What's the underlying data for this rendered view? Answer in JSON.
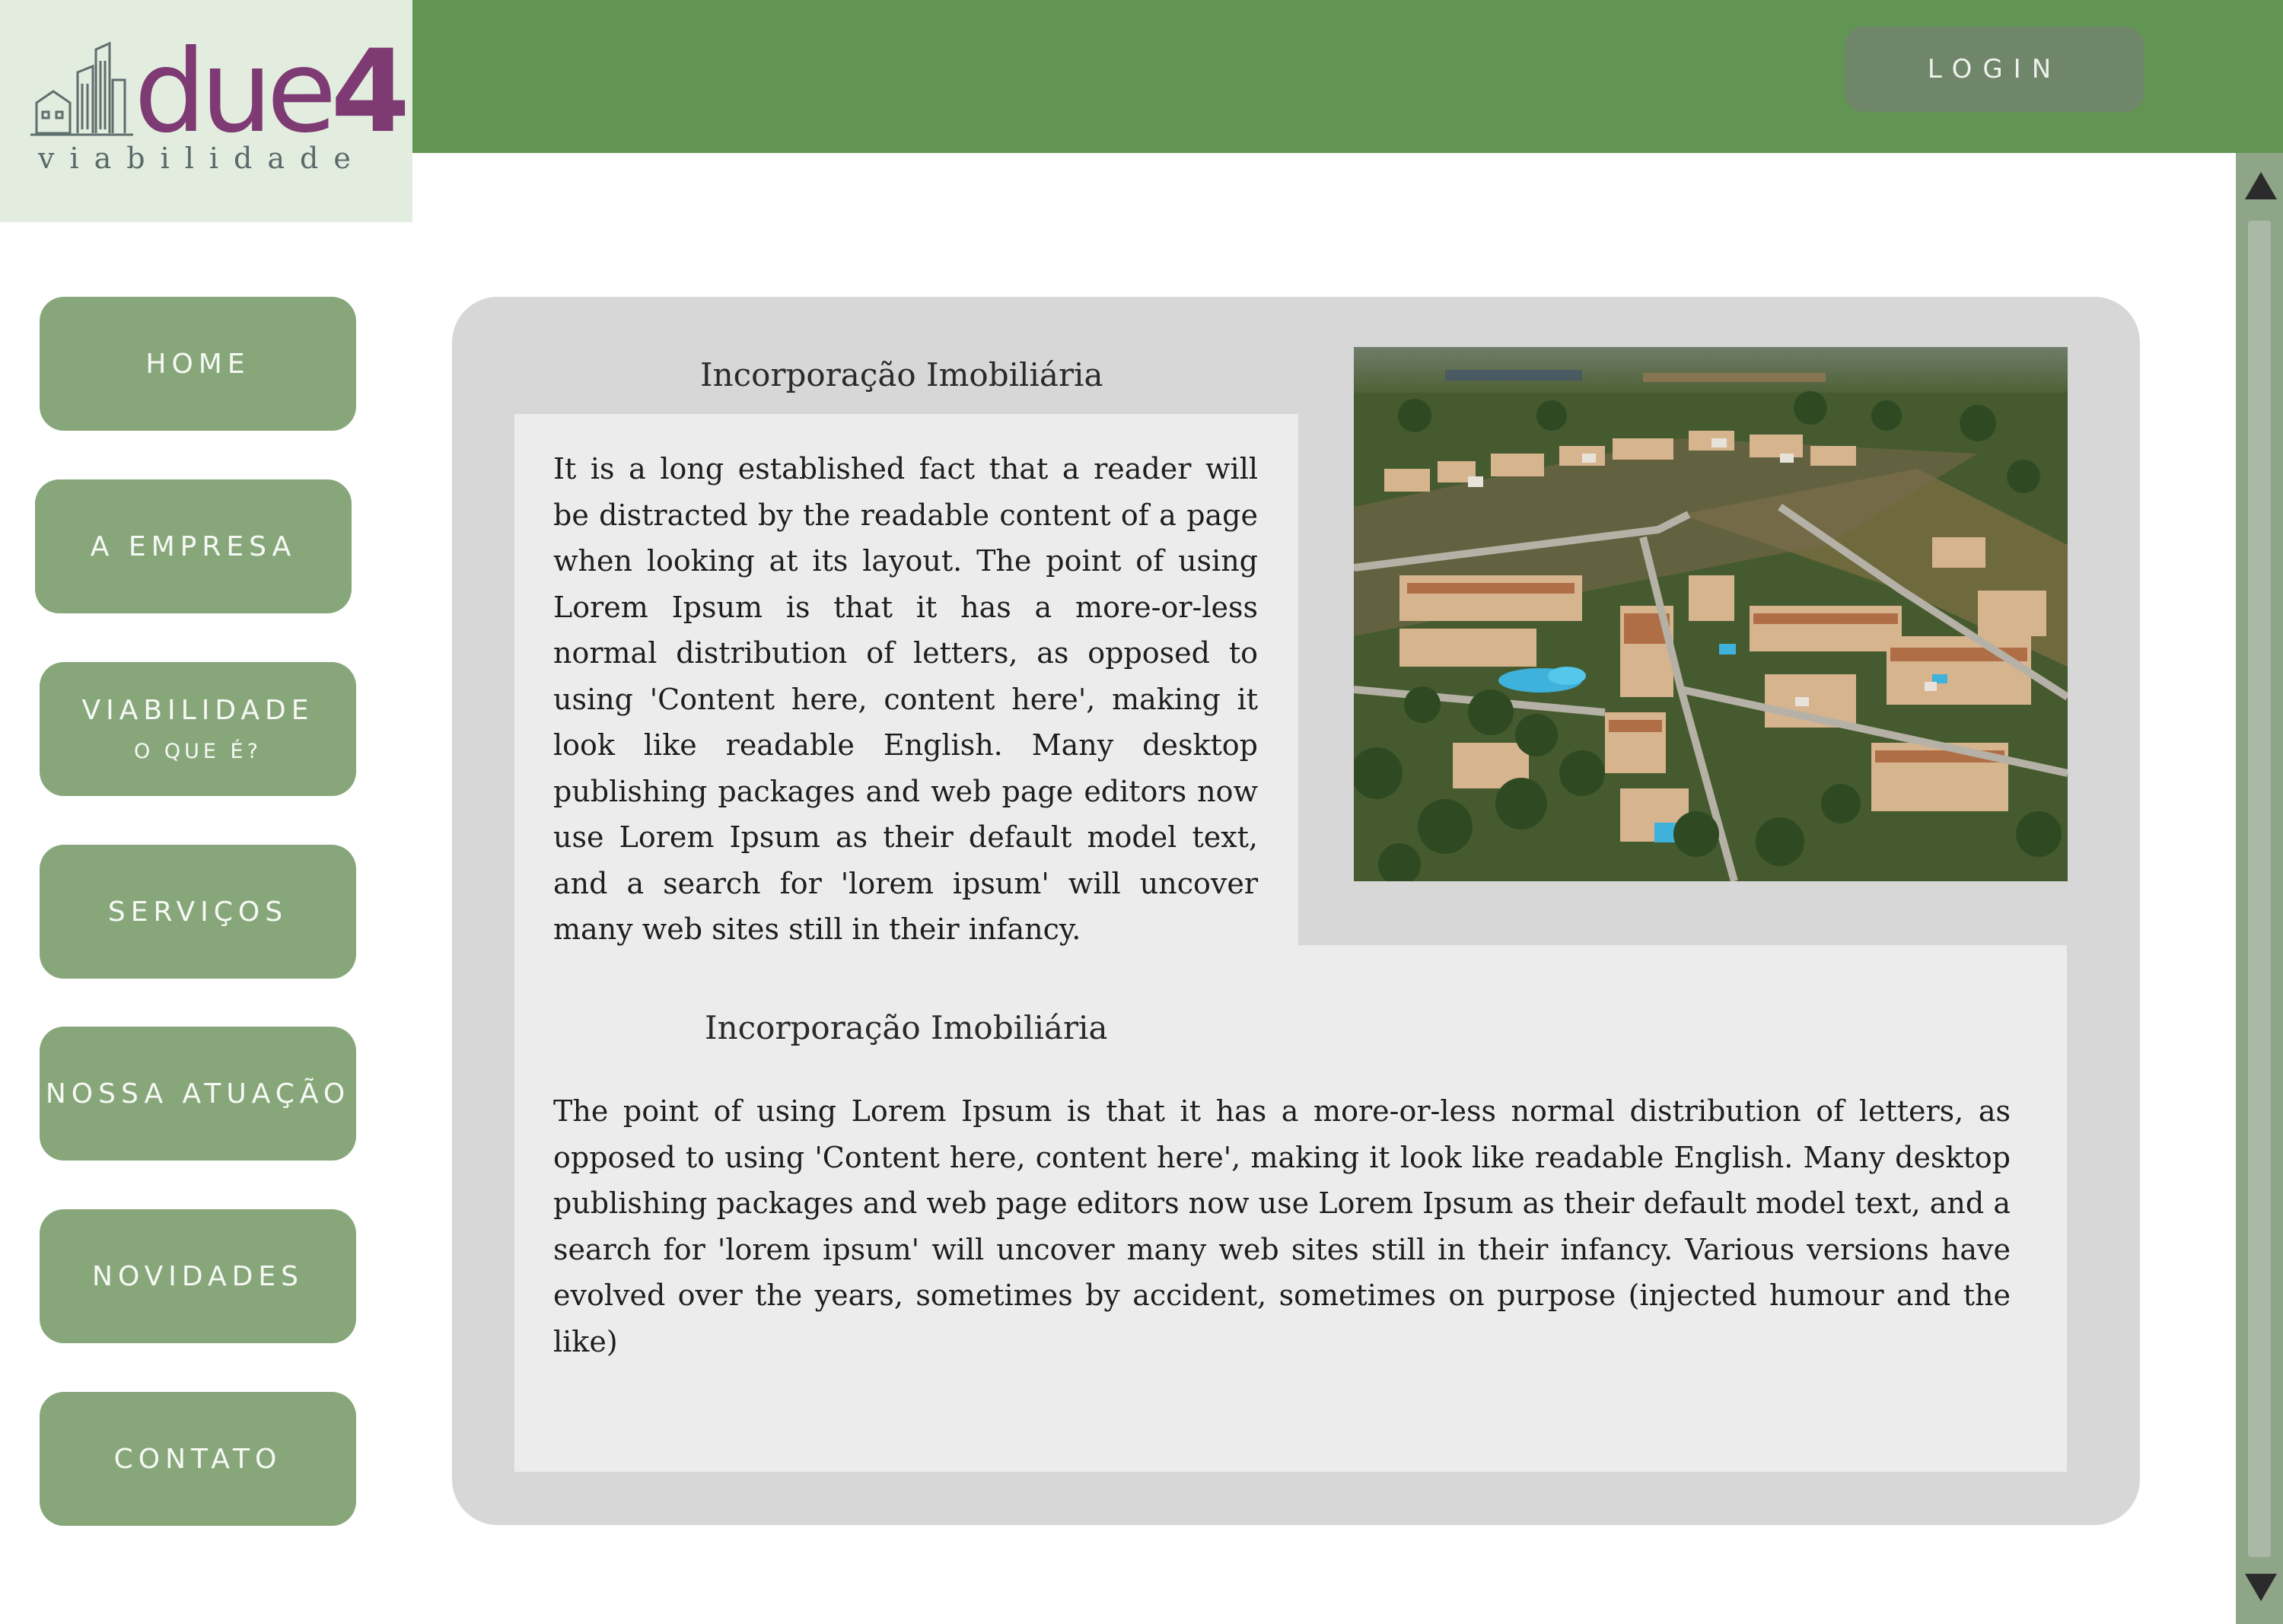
{
  "logo": {
    "word_main": "due",
    "word_number": "4",
    "tagline": "viabilidade"
  },
  "header": {
    "login_label": "LOGIN"
  },
  "nav": {
    "home": "HOME",
    "empresa": "A EMPRESA",
    "viabilidade": "VIABILIDADE",
    "viabilidade_sub": "O QUE É?",
    "servicos": "SERVIÇOS",
    "atuacao": "NOSSA ATUAÇÃO",
    "novidades": "NOVIDADES",
    "contato": "CONTATO"
  },
  "content": {
    "section1": {
      "title": "Incorporação Imobiliária",
      "body": "It is a long established fact that a reader will be distracted by the readable content of a page when looking at its layout. The point of using Lorem Ipsum is that it has a more-or-less normal distribution of letters, as opposed to using 'Content here, content here', making it look like readable English. Many desktop publishing packages and web page editors now use Lorem Ipsum as their default model text, and a search for 'lorem ipsum' will uncover many web sites still in their infancy."
    },
    "section2": {
      "title": "Incorporação Imobiliária",
      "body": "The point of using Lorem Ipsum is that it has a more-or-less normal distribution of letters, as opposed to using 'Content here, content here', making it look like readable English. Many desktop publishing packages and web page editors now use Lorem Ipsum as their default model text, and a search for 'lorem ipsum' will uncover many web sites still in their infancy. Various versions have evolved over the years, sometimes by accident, sometimes on purpose (injected humour and the like)"
    }
  },
  "colors": {
    "header_green": "#629553",
    "nav_button": "#87a77b",
    "login_button": "#6f866a",
    "logo_purple": "#7e3a72",
    "panel_gray": "#d7d7d7",
    "card_gray": "#ececec"
  },
  "icons": {
    "logo_buildings": "buildings-icon",
    "scroll_up": "triangle-up-icon",
    "scroll_down": "triangle-down-icon"
  }
}
